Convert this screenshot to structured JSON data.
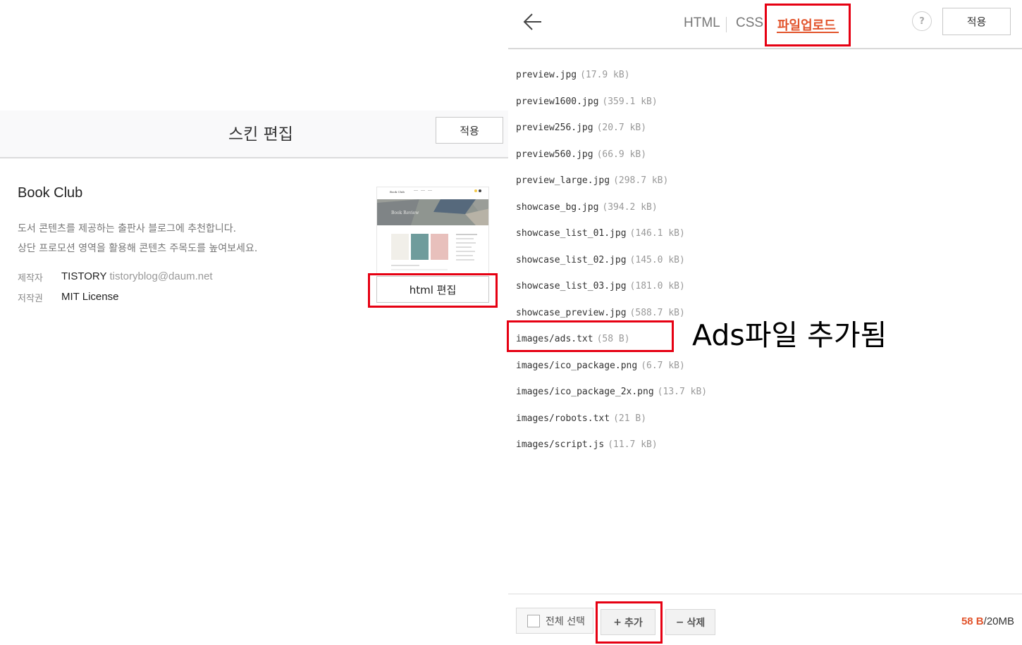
{
  "left": {
    "header_title": "스킨 편집",
    "apply_label": "적용",
    "skin": {
      "name": "Book Club",
      "desc_line1": "도서 콘텐츠를 제공하는 출판사 블로그에 추천합니다.",
      "desc_line2": "상단 프로모션 영역을 활용해 콘텐츠 주목도를 높여보세요.",
      "maker_label": "제작자",
      "maker_value": "TISTORY",
      "maker_email": "tistoryblog@daum.net",
      "copyright_label": "저작권",
      "copyright_value": "MIT License"
    },
    "thumbnail": {
      "site_title": "Book Club",
      "banner_text": "Book Review"
    },
    "html_edit_label": "html 편집"
  },
  "right": {
    "tabs": [
      "HTML",
      "CSS",
      "파일업로드"
    ],
    "active_tab": "파일업로드",
    "help_label": "?",
    "apply_label": "적용",
    "files": [
      {
        "name": "preview.jpg",
        "size": "(17.9 kB)"
      },
      {
        "name": "preview1600.jpg",
        "size": "(359.1 kB)"
      },
      {
        "name": "preview256.jpg",
        "size": "(20.7 kB)"
      },
      {
        "name": "preview560.jpg",
        "size": "(66.9 kB)"
      },
      {
        "name": "preview_large.jpg",
        "size": "(298.7 kB)"
      },
      {
        "name": "showcase_bg.jpg",
        "size": "(394.2 kB)"
      },
      {
        "name": "showcase_list_01.jpg",
        "size": "(146.1 kB)"
      },
      {
        "name": "showcase_list_02.jpg",
        "size": "(145.0 kB)"
      },
      {
        "name": "showcase_list_03.jpg",
        "size": "(181.0 kB)"
      },
      {
        "name": "showcase_preview.jpg",
        "size": "(588.7 kB)"
      },
      {
        "name": "images/ads.txt",
        "size": "(58 B)"
      },
      {
        "name": "images/ico_package.png",
        "size": "(6.7 kB)"
      },
      {
        "name": "images/ico_package_2x.png",
        "size": "(13.7 kB)"
      },
      {
        "name": "images/robots.txt",
        "size": "(21 B)"
      },
      {
        "name": "images/script.js",
        "size": "(11.7 kB)"
      }
    ],
    "footer": {
      "select_all_label": "전체 선택",
      "add_label": "추가",
      "delete_label": "삭제",
      "quota_used": "58 B",
      "quota_separator": "/",
      "quota_total": "20MB"
    }
  },
  "annotation": "Ads파일 추가됨",
  "colors": {
    "accent": "#e2542c",
    "highlight_box": "#e60012"
  }
}
